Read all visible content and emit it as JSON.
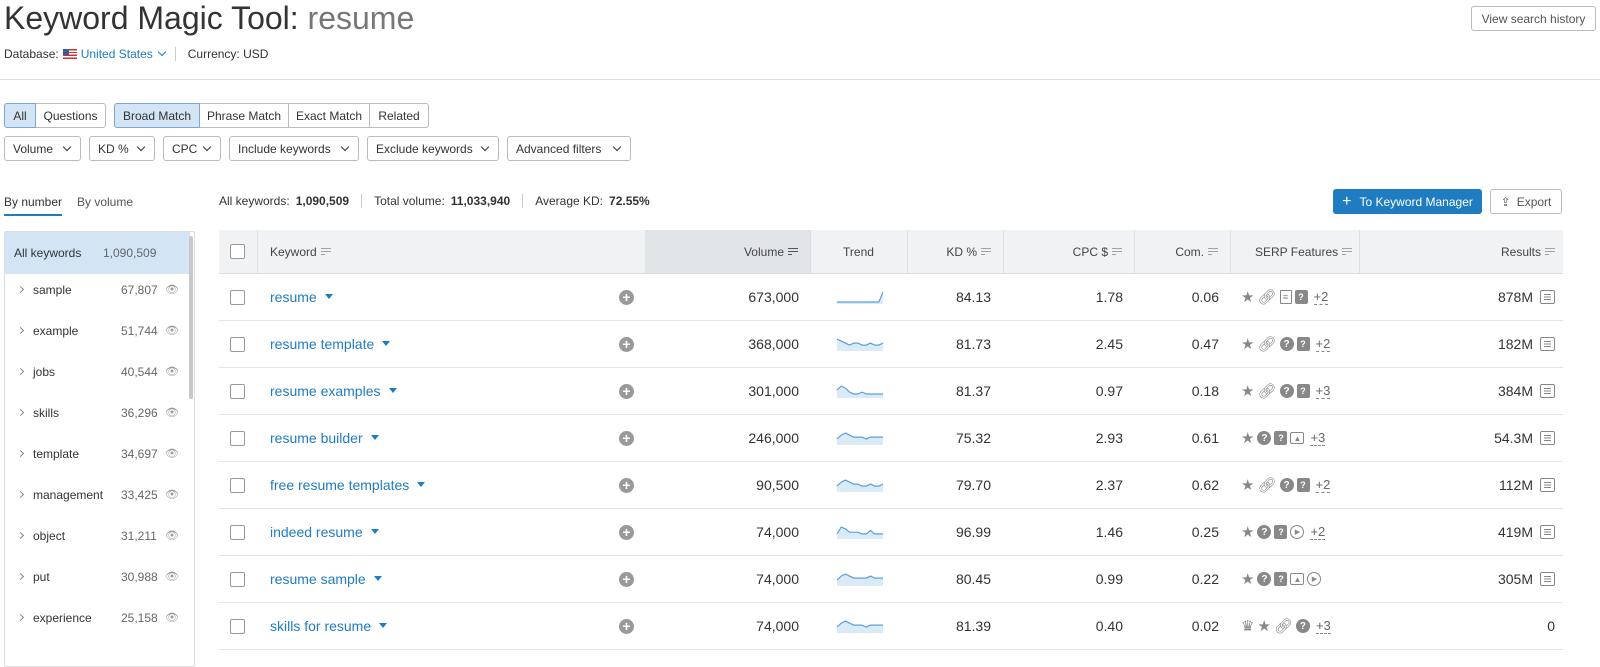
{
  "header": {
    "title_prefix": "Keyword Magic Tool:",
    "title_query": "resume",
    "database_label": "Database:",
    "database_value": "United States",
    "currency_label": "Currency: USD",
    "history_button": "View search history"
  },
  "scope_tabs": [
    "All",
    "Questions"
  ],
  "match_tabs": [
    "Broad Match",
    "Phrase Match",
    "Exact Match",
    "Related"
  ],
  "filters": [
    "Volume",
    "KD %",
    "CPC",
    "Include keywords",
    "Exclude keywords",
    "Advanced filters"
  ],
  "group_tabs": {
    "by_number": "By number",
    "by_volume": "By volume"
  },
  "stats": {
    "all_keywords_label": "All keywords:",
    "all_keywords_value": "1,090,509",
    "total_volume_label": "Total volume:",
    "total_volume_value": "11,033,940",
    "avg_kd_label": "Average KD:",
    "avg_kd_value": "72.55%"
  },
  "actions": {
    "keyword_manager": "To Keyword Manager",
    "export": "Export"
  },
  "sidebar": {
    "all_label": "All keywords",
    "all_count": "1,090,509",
    "groups": [
      {
        "label": "sample",
        "count": "67,807"
      },
      {
        "label": "example",
        "count": "51,744"
      },
      {
        "label": "jobs",
        "count": "40,544"
      },
      {
        "label": "skills",
        "count": "36,296"
      },
      {
        "label": "template",
        "count": "34,697"
      },
      {
        "label": "management",
        "count": "33,425"
      },
      {
        "label": "object",
        "count": "31,211"
      },
      {
        "label": "put",
        "count": "30,988"
      },
      {
        "label": "experience",
        "count": "25,158"
      }
    ]
  },
  "table": {
    "headers": {
      "keyword": "Keyword",
      "volume": "Volume",
      "trend": "Trend",
      "kd": "KD %",
      "cpc": "CPC $",
      "com": "Com.",
      "serp": "SERP Features",
      "results": "Results"
    },
    "rows": [
      {
        "keyword": "resume",
        "volume": "673,000",
        "kd": "84.13",
        "cpc": "1.78",
        "com": "0.06",
        "serp_icons": [
          "star",
          "link",
          "doc",
          "faq"
        ],
        "serp_more": "+2",
        "results": "878M",
        "trend": [
          1,
          1,
          1,
          1,
          1,
          1,
          1,
          1,
          1,
          1,
          1,
          6
        ]
      },
      {
        "keyword": "resume template",
        "volume": "368,000",
        "kd": "81.73",
        "cpc": "2.45",
        "com": "0.47",
        "serp_icons": [
          "star",
          "link",
          "question",
          "faq"
        ],
        "serp_more": "+2",
        "results": "182M",
        "trend": [
          6,
          5,
          4,
          3,
          4,
          4,
          3,
          3,
          4,
          3,
          3,
          4
        ]
      },
      {
        "keyword": "resume examples",
        "volume": "301,000",
        "kd": "81.37",
        "cpc": "0.97",
        "com": "0.18",
        "serp_icons": [
          "star",
          "link",
          "question",
          "faq"
        ],
        "serp_more": "+3",
        "results": "384M",
        "trend": [
          4,
          6,
          5,
          3,
          2,
          2,
          3,
          2,
          2,
          2,
          2,
          2
        ]
      },
      {
        "keyword": "resume builder",
        "volume": "246,000",
        "kd": "75.32",
        "cpc": "2.93",
        "com": "0.61",
        "serp_icons": [
          "star",
          "question",
          "faq",
          "image"
        ],
        "serp_more": "+3",
        "results": "54.3M",
        "trend": [
          3,
          5,
          6,
          5,
          4,
          4,
          4,
          3,
          4,
          4,
          4,
          4
        ]
      },
      {
        "keyword": "free resume templates",
        "volume": "90,500",
        "kd": "79.70",
        "cpc": "2.37",
        "com": "0.62",
        "serp_icons": [
          "star",
          "link",
          "question",
          "faq"
        ],
        "serp_more": "+2",
        "results": "112M",
        "trend": [
          3,
          5,
          6,
          5,
          4,
          4,
          3,
          3,
          4,
          3,
          3,
          4
        ]
      },
      {
        "keyword": "indeed resume",
        "volume": "74,000",
        "kd": "96.99",
        "cpc": "1.46",
        "com": "0.25",
        "serp_icons": [
          "star",
          "question",
          "faq",
          "video"
        ],
        "serp_more": "+2",
        "results": "419M",
        "trend": [
          3,
          7,
          6,
          4,
          4,
          4,
          3,
          3,
          5,
          3,
          3,
          3
        ]
      },
      {
        "keyword": "resume sample",
        "volume": "74,000",
        "kd": "80.45",
        "cpc": "0.99",
        "com": "0.22",
        "serp_icons": [
          "star",
          "question",
          "faq",
          "image",
          "video"
        ],
        "serp_more": "",
        "results": "305M",
        "trend": [
          3,
          5,
          6,
          5,
          4,
          4,
          4,
          4,
          5,
          4,
          4,
          4
        ]
      },
      {
        "keyword": "skills for resume",
        "volume": "74,000",
        "kd": "81.39",
        "cpc": "0.40",
        "com": "0.02",
        "serp_icons": [
          "crown",
          "star",
          "link",
          "question"
        ],
        "serp_more": "+3",
        "results": "0",
        "trend": [
          3,
          5,
          6,
          5,
          4,
          4,
          4,
          3,
          4,
          4,
          4,
          4
        ]
      }
    ]
  },
  "colors": {
    "accent": "#1f7cc1",
    "active_tab_bg": "#d3e4f5",
    "trend_line": "#5aa0dc",
    "trend_fill": "#dbeaf7"
  }
}
